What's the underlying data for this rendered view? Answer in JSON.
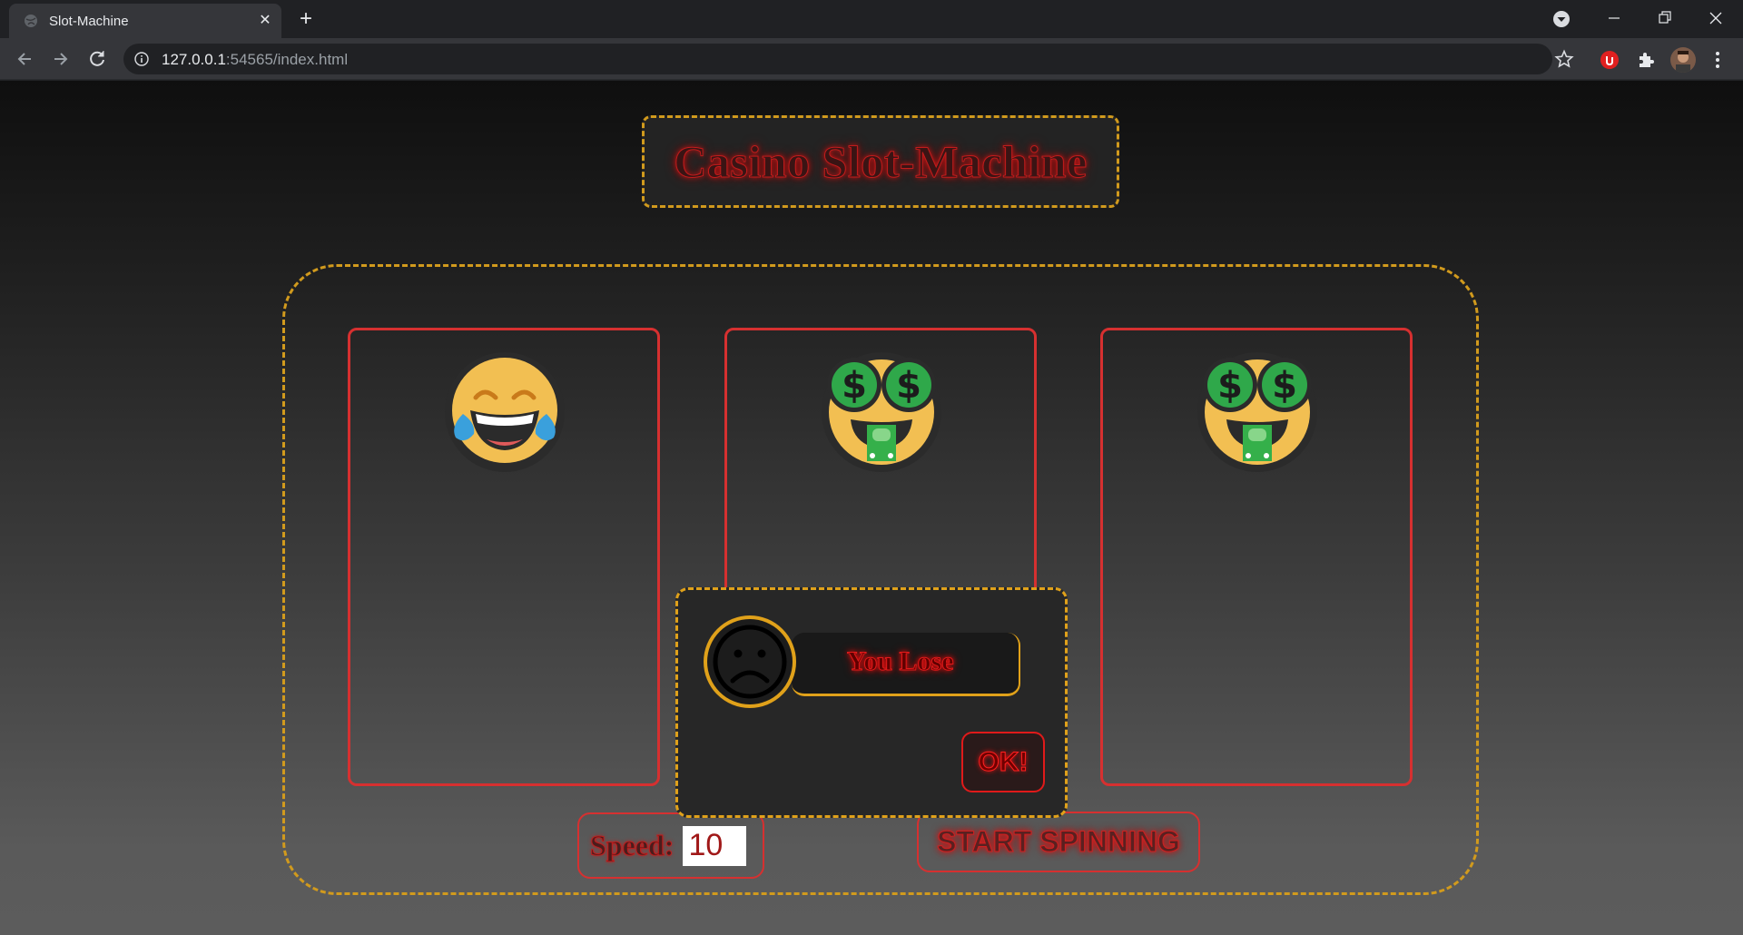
{
  "browser": {
    "tab_title": "Slot-Machine",
    "url_host": "127.0.0.1",
    "url_rest": ":54565/index.html"
  },
  "page": {
    "title": "Casino Slot-Machine",
    "reels": [
      {
        "symbol": "face-with-tears-of-joy"
      },
      {
        "symbol": "money-mouth-face"
      },
      {
        "symbol": "money-mouth-face"
      }
    ],
    "speed_label": "Speed:",
    "speed_value": "10",
    "start_label": "START SPINNING"
  },
  "modal": {
    "result_text": "You Lose",
    "ok_label": "OK!",
    "icon": "sad-face-icon"
  },
  "colors": {
    "accent_gold": "#d19a1d",
    "neon_red": "#d63030"
  }
}
